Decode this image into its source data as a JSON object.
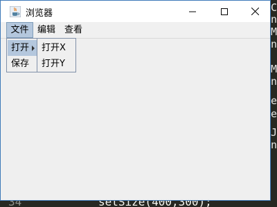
{
  "window": {
    "title": "浏览器",
    "minimize_icon": "minimize-icon",
    "maximize_icon": "maximize-icon",
    "close_icon": "close-icon"
  },
  "menubar": {
    "items": [
      {
        "label": "文件"
      },
      {
        "label": "编辑"
      },
      {
        "label": "查看"
      }
    ]
  },
  "file_menu": {
    "items": [
      {
        "label": "打开"
      },
      {
        "label": "保存"
      }
    ]
  },
  "open_submenu": {
    "items": [
      {
        "label": "打开X"
      },
      {
        "label": "打开Y"
      }
    ]
  },
  "background_editor": {
    "line_number": "34",
    "code_line": "setSize(400,300);",
    "right_edge_chars": [
      "C",
      "n",
      "M",
      "n",
      "M",
      "n",
      "e",
      "e",
      "J",
      "n"
    ]
  },
  "colors": {
    "selection": "#b4c7dd",
    "window_border": "#3c78b8",
    "menubar": "#f0f0f0"
  }
}
